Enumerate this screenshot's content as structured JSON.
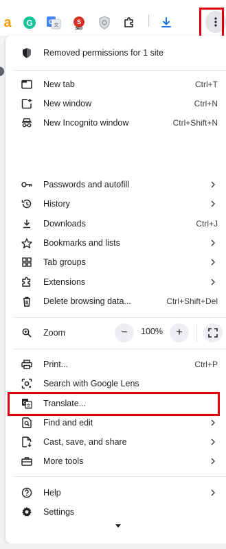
{
  "colors": {
    "highlight": "#e0000b",
    "menu_bg": "#ffffff",
    "text": "#1f1f1f",
    "accent_blue": "#1a73e8"
  },
  "toolbar": {
    "extensions": [
      {
        "name": "amazon-icon",
        "glyph": "a"
      },
      {
        "name": "grammarly-icon",
        "glyph": "G"
      },
      {
        "name": "google-translate-icon",
        "glyph": "G"
      },
      {
        "name": "seo-icon",
        "glyph": "SEO"
      },
      {
        "name": "shield-extension-icon",
        "glyph": ""
      },
      {
        "name": "puzzle-extensions-icon",
        "glyph": ""
      },
      {
        "name": "download-icon",
        "glyph": ""
      }
    ],
    "menu_button_icon": "three-dots-vertical-icon"
  },
  "menu": {
    "permissions_notice": "Removed permissions for 1 site",
    "new_tab": {
      "label": "New tab",
      "shortcut": "Ctrl+T"
    },
    "new_window": {
      "label": "New window",
      "shortcut": "Ctrl+N"
    },
    "new_incognito": {
      "label": "New Incognito window",
      "shortcut": "Ctrl+Shift+N"
    },
    "passwords": {
      "label": "Passwords and autofill"
    },
    "history": {
      "label": "History"
    },
    "downloads": {
      "label": "Downloads",
      "shortcut": "Ctrl+J"
    },
    "bookmarks": {
      "label": "Bookmarks and lists"
    },
    "tab_groups": {
      "label": "Tab groups"
    },
    "extensions": {
      "label": "Extensions"
    },
    "delete_browsing": {
      "label": "Delete browsing data...",
      "shortcut": "Ctrl+Shift+Del"
    },
    "zoom": {
      "label": "Zoom",
      "value": "100%",
      "minus": "−",
      "plus": "+"
    },
    "print": {
      "label": "Print...",
      "shortcut": "Ctrl+P"
    },
    "lens": {
      "label": "Search with Google Lens"
    },
    "translate": {
      "label": "Translate..."
    },
    "find_edit": {
      "label": "Find and edit"
    },
    "cast_save_share": {
      "label": "Cast, save, and share"
    },
    "more_tools": {
      "label": "More tools"
    },
    "help": {
      "label": "Help"
    },
    "settings": {
      "label": "Settings"
    }
  }
}
